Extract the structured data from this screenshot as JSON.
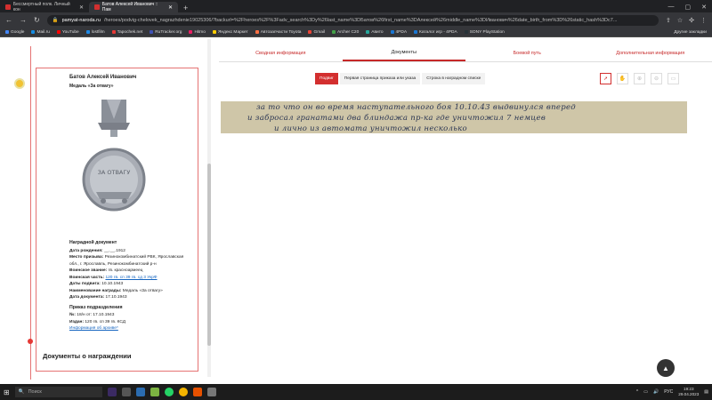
{
  "browser": {
    "tabs": [
      {
        "title": "Бессмертный полк. Личный кон",
        "active": false
      },
      {
        "title": "Батов Алексей Иванович :: Пам",
        "active": true
      }
    ],
    "address": {
      "host": "pamyat-naroda.ru",
      "path": "/heroes/podvig-chelovek_nagrazhdenie19025306/?backurl=%2Fheroes%2F%3Fadv_search%3Dy%26last_name%3DБатов%26first_name%3DАлексей%26middle_name%3DИванович%26date_birth_from%3D%26static_hash%3Dc7..."
    },
    "bookmarks": [
      "Google",
      "Mail.ru",
      "YouTube",
      "lostfilm",
      "Tapochek.net",
      "RuTracker.org",
      "Hitmo",
      "Яндекс Маркет",
      "Автозапчасти Toyota",
      "Gmail",
      "Archer C20",
      "Авито",
      "4PDA",
      "Каталог игр - 4PDA",
      "SONY PlayStation"
    ],
    "bookmarks_right": "Другие закладки"
  },
  "card": {
    "name": "Батов Алексей Иванович",
    "award": "Медаль «За отвагу»",
    "medal_text": "ЗА ОТВАГУ",
    "section_title": "Наградной документ",
    "rows": [
      {
        "label": "Дата рождения:",
        "value": "__.__.1912"
      },
      {
        "label": "Место призыва:",
        "value": "Резинокомбинатский РВК, Ярославская обл., г. Ярославль, Резинокомбинатский р-н"
      },
      {
        "label": "Воинское звание:",
        "value": "гв. красноармеец"
      },
      {
        "label": "Воинская часть:",
        "value": "120 гв. сп 39 гв. сд 3 УкрФ",
        "link": true
      },
      {
        "label": "Даты подвига:",
        "value": "10.10.1943"
      },
      {
        "label": "Наименование награды:",
        "value": "Медаль «За отвагу»"
      },
      {
        "label": "Дата документа:",
        "value": "17.10.1943"
      }
    ],
    "order_title": "Приказ подразделения",
    "order_rows": [
      {
        "label": "№:",
        "value": "18/н от: 17.10.1943"
      },
      {
        "label": "Издан:",
        "value": "120 гв. сп 39 гв. КСД"
      }
    ],
    "archive_link": "Информация об архиве*"
  },
  "timeline": {
    "year": "1945"
  },
  "docs_heading": "Документы о награждении",
  "nav_tabs": [
    {
      "label": "Сводная информация",
      "active": false
    },
    {
      "label": "Документы",
      "active": true
    },
    {
      "label": "Боевой путь",
      "active": false
    },
    {
      "label": "Дополнительная информация",
      "active": false
    }
  ],
  "sub_tabs": [
    {
      "label": "Подвиг",
      "active": true
    },
    {
      "label": "Первая страница приказа или указа",
      "active": false
    },
    {
      "label": "Строка в наградном списке",
      "active": false
    }
  ],
  "tools": [
    "cursor-icon",
    "hand-icon",
    "zoom-in-icon",
    "zoom-out-icon",
    "fullscreen-icon"
  ],
  "document_text": {
    "line1": "за то что он во время наступательного боя 10.10.43 выдвинулся вперед",
    "line2": "и забросал гранатами два блиндажа пр-ка где уничтожил 7 немцев",
    "line3": "и лично из автомата уничтожил несколько"
  },
  "taskbar": {
    "search_placeholder": "Поиск",
    "lang": "РУС",
    "time": "19:23",
    "date": "29.04.2023"
  },
  "colors": {
    "accent": "#d32f2f",
    "document_bg": "#cfc6a8",
    "ink": "#2a3552"
  }
}
